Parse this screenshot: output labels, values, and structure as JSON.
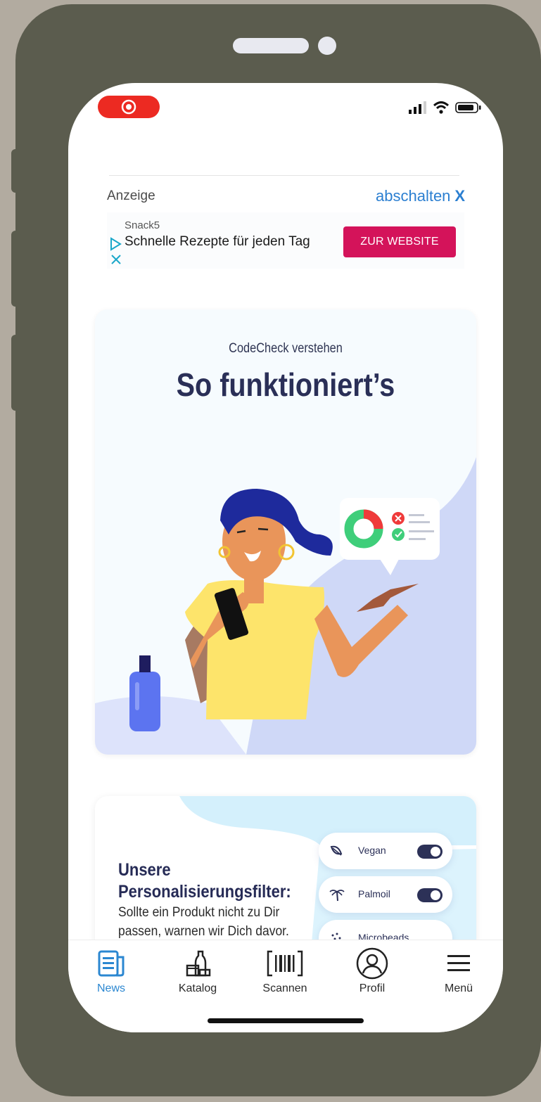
{
  "ad": {
    "label": "Anzeige",
    "dismiss_label": "abschalten",
    "dismiss_icon": "X",
    "sponsor": "Snack5",
    "title": "Schnelle Rezepte für jeden Tag",
    "cta": "ZUR WEBSITE",
    "cta_color": "#d4135a"
  },
  "hero_card": {
    "subtitle": "CodeCheck verstehen",
    "title": "So funktioniert’s"
  },
  "filter_card": {
    "heading": "Unsere Personalisierungsfilter:",
    "body": "Sollte ein Produkt nicht zu Dir passen, warnen wir Dich davor.",
    "filters": [
      {
        "label": "Vegan",
        "icon": "leaf-icon",
        "enabled": true
      },
      {
        "label": "Palmoil",
        "icon": "palm-tree-icon",
        "enabled": true
      },
      {
        "label": "Microbeads",
        "icon": "microbeads-icon",
        "enabled": false
      }
    ]
  },
  "tabs": [
    {
      "label": "News",
      "icon": "news-icon",
      "active": true
    },
    {
      "label": "Katalog",
      "icon": "catalog-icon",
      "active": false
    },
    {
      "label": "Scannen",
      "icon": "barcode-scan-icon",
      "active": false
    },
    {
      "label": "Profil",
      "icon": "profile-icon",
      "active": false
    },
    {
      "label": "Menü",
      "icon": "menu-icon",
      "active": false
    }
  ],
  "colors": {
    "accent_blue": "#2b87d1",
    "navy": "#2a2f57",
    "recording_pill": "#ec2a22"
  }
}
